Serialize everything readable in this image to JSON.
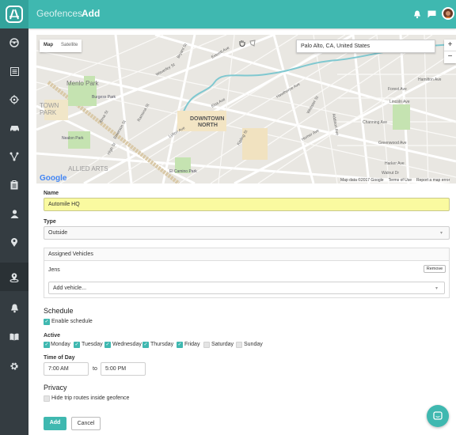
{
  "header": {
    "section": "Geofences",
    "page": "Add"
  },
  "colors": {
    "accent": "#3fb8b0",
    "sidebar": "#343c41",
    "name_highlight": "#fafaa0"
  },
  "sidebar": {
    "icons": [
      "steering-wheel-icon",
      "list-icon",
      "target-icon",
      "car-icon",
      "routes-icon",
      "clipboard-icon",
      "person-icon",
      "location-pin-icon",
      "geofence-icon",
      "bell-icon",
      "book-icon",
      "gear-icon"
    ],
    "active": "geofence-icon"
  },
  "map": {
    "tab_map": "Map",
    "tab_satellite": "Satellite",
    "search": "Palo Alto, CA, United States",
    "zoom_in": "+",
    "zoom_out": "−",
    "google": "Google",
    "map_data": "Map data ©2017 Google",
    "terms": "Terms of Use",
    "report": "Report a map error",
    "labels": {
      "menlo": "Menlo Park",
      "burgess": "Burgess Park",
      "downtown1": "DOWNTOWN",
      "downtown2": "NORTH",
      "town1": "TOWN",
      "town2": "PARK",
      "nealon": "Nealon Park",
      "allied": "ALLIED ARTS",
      "elcamino": "El Camino Park",
      "forest": "Forest Ave",
      "hamilton": "Hamilton Ave",
      "lincoln": "Lincoln Ave",
      "channing": "Channing Ave",
      "greenwood": "Greenwood Ave",
      "harker": "Harker Ave",
      "walnut": "Walnut Dr",
      "waverley": "Waverley St",
      "bryant": "Bryant St",
      "ramona": "Ramona St",
      "emerson": "Emerson St",
      "high": "High St",
      "alma": "Alma St",
      "kipling": "Kipling St",
      "lytton": "Lytton Ave",
      "everett": "Everett Ave",
      "homer": "Homer Ave",
      "addison": "Addison Ave",
      "hawthorne": "Hawthorne Ave",
      "webster": "Webster St",
      "elsa": "Elsa Ave"
    }
  },
  "form": {
    "name_label": "Name",
    "name_value": "Automile HQ",
    "type_label": "Type",
    "type_value": "Outside",
    "assigned_header": "Assigned Vehicles",
    "vehicle": "Jens",
    "remove": "Remove",
    "add_vehicle": "Add vehicle...",
    "schedule_title": "Schedule",
    "enable_schedule": "Enable schedule",
    "active_label": "Active",
    "days": [
      {
        "label": "Monday",
        "on": true
      },
      {
        "label": "Tuesday",
        "on": true
      },
      {
        "label": "Wednesday",
        "on": true
      },
      {
        "label": "Thursday",
        "on": true
      },
      {
        "label": "Friday",
        "on": true
      },
      {
        "label": "Saturday",
        "on": false
      },
      {
        "label": "Sunday",
        "on": false
      }
    ],
    "time_label": "Time of Day",
    "time_from": "7:00 AM",
    "time_to_sep": "to",
    "time_to": "5:00 PM",
    "privacy_title": "Privacy",
    "hide_trips": "Hide trip routes inside geofence",
    "add_button": "Add",
    "cancel_button": "Cancel"
  }
}
